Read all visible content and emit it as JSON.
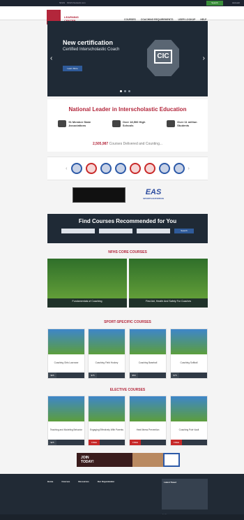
{
  "topbar": {
    "links": [
      "NFHS",
      "NFHS Network.com"
    ],
    "search_label": "Search",
    "account_label": "Account"
  },
  "brand": {
    "line1": "LEARNING",
    "line2": "CENTER"
  },
  "nav": {
    "items": [
      "COURSES",
      "COACHING REQUIREMENTS",
      "USER LOOKUP",
      "HELP"
    ]
  },
  "hero": {
    "title": "New certification",
    "subtitle": "Certified Interscholastic Coach",
    "body": "",
    "button": "Learn More",
    "badge": "CIC"
  },
  "leader": {
    "heading": "National Leader in Interscholastic Education",
    "stats": [
      {
        "value": "51 Member State",
        "label": "Associations"
      },
      {
        "value": "Over 18,500 High",
        "label": "Schools"
      },
      {
        "value": "Over 11 million",
        "label": "Students"
      }
    ],
    "count_number": "2,505,987",
    "count_text": "Courses Delivered and Counting..."
  },
  "sponsors": {
    "eas": "EAS",
    "eas_sub": "SPORTS NUTRITION"
  },
  "find": {
    "heading": "Find Courses Recommended for You",
    "selects": [
      "",
      "",
      ""
    ],
    "button": "Search"
  },
  "core": {
    "heading": "NFHS CORE COURSES",
    "courses": [
      {
        "title": "Fundamentals of Coaching",
        "sub": ""
      },
      {
        "title": "First Aid, Health And Safety For Coaches",
        "sub": ""
      }
    ]
  },
  "sport": {
    "heading": "SPORT-SPECIFIC COURSES",
    "courses": [
      {
        "title": "Coaching Girls Lacrosse",
        "price": "$65"
      },
      {
        "title": "Coaching Field Hockey",
        "price": "$75"
      },
      {
        "title": "Coaching Baseball",
        "price": "$50"
      },
      {
        "title": "Coaching Softball",
        "price": "$75"
      }
    ]
  },
  "elective": {
    "heading": "ELECTIVE COURSES",
    "courses": [
      {
        "title": "Teaching and Modeling Behavior",
        "price": "$25"
      },
      {
        "title": "Engaging Effectively With Parents",
        "price": "FREE"
      },
      {
        "title": "Heat Illness Prevention",
        "price": "FREE"
      },
      {
        "title": "Coaching Pole Vault",
        "price": "FREE"
      }
    ]
  },
  "join": {
    "text1": "JOIN",
    "text2": "TODAY!"
  },
  "footer": {
    "columns": [
      {
        "head": "Home"
      },
      {
        "head": "Courses"
      },
      {
        "head": "Resources"
      },
      {
        "head": "Our Organization"
      }
    ],
    "box_title": "Latest Tweet"
  },
  "colors": {
    "brand_red": "#b3263b",
    "navy": "#1f2a36",
    "blue": "#2f5b9a"
  }
}
